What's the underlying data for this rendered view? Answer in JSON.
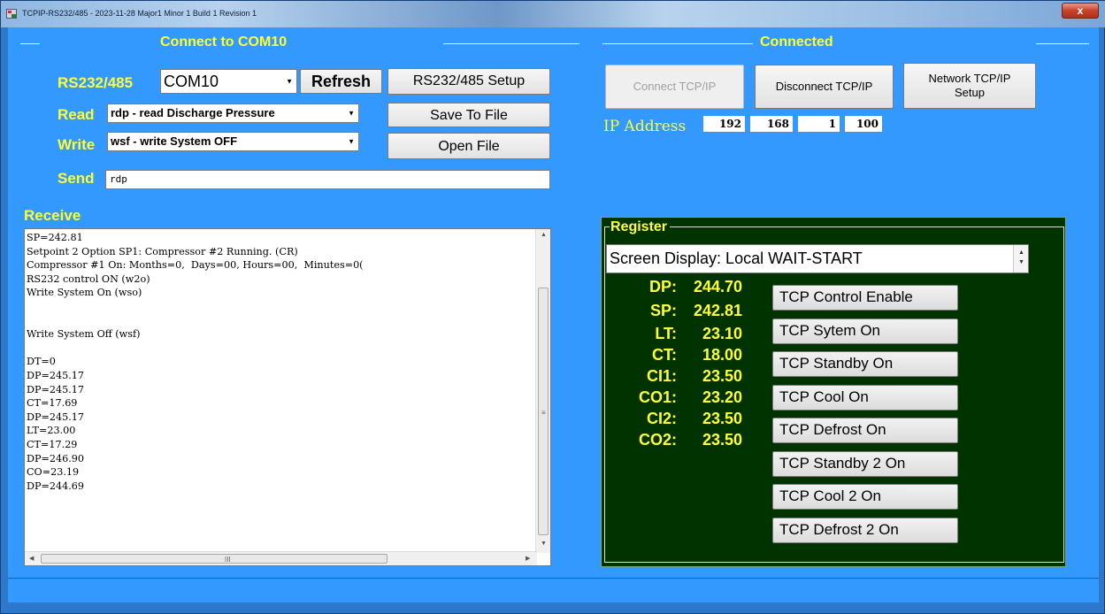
{
  "window": {
    "title": "TCPIP-RS232/485 - 2023-11-28 Major1 Minor 1 Build 1 Revision 1",
    "close": "x"
  },
  "com_group": {
    "title": "Connect to COM10",
    "rs_label": "RS232/485",
    "com_port": "COM10",
    "refresh": "Refresh",
    "setup": "RS232/485 Setup",
    "read_label": "Read",
    "read_selected": "rdp - read Discharge Pressure",
    "save": "Save To File",
    "write_label": "Write",
    "write_selected": "wsf - write System OFF",
    "open": "Open File",
    "send_label": "Send",
    "send_value": "rdp"
  },
  "tcp_group": {
    "title": "Connected",
    "connect": "Connect TCP/IP",
    "disconnect": "Disconnect TCP/IP",
    "network_line1": "Network TCP/IP",
    "network_line2": "Setup",
    "ip_label": "IP Address",
    "ip": [
      "192",
      "168",
      "1",
      "100"
    ]
  },
  "receive": {
    "label": "Receive",
    "lines": [
      "SP=242.81",
      "Setpoint 2 Option SP1: Compressor #2 Running. (CR)",
      "Compressor #1 On: Months=0,  Days=00, Hours=00,  Minutes=0(",
      "RS232 control ON (w2o)",
      "Write System On (wso)",
      "",
      "",
      "Write System Off (wsf)",
      "",
      "DT=0",
      "DP=245.17",
      "DP=245.17",
      "CT=17.69",
      "DP=245.17",
      "LT=23.00",
      "CT=17.29",
      "DP=246.90",
      "CO=23.19",
      "DP=244.69"
    ],
    "hscroll_grip": "III",
    "vscroll_grip": "≡"
  },
  "register": {
    "title": "Register",
    "screen_display": "Screen Display: Local WAIT-START",
    "readings": [
      {
        "key": "DP:",
        "value": "244.70"
      },
      {
        "key": "SP:",
        "value": "242.81"
      },
      {
        "key": "LT:",
        "value": "23.10"
      },
      {
        "key": "CT:",
        "value": "18.00"
      },
      {
        "key": "CI1:",
        "value": "23.50"
      },
      {
        "key": "CO1:",
        "value": "23.20"
      },
      {
        "key": "CI2:",
        "value": "23.50"
      },
      {
        "key": "CO2:",
        "value": "23.50"
      }
    ],
    "buttons": [
      "TCP Control Enable",
      "TCP Sytem On",
      "TCP Standby On",
      "TCP Cool On",
      "TCP Defrost On",
      "TCP Standby 2 On",
      "TCP Cool 2 On",
      "TCP Defrost 2 On"
    ]
  },
  "colors": {
    "background": "#3399ff",
    "label_yellow": "#ffff33",
    "register_bg": "#003300"
  }
}
